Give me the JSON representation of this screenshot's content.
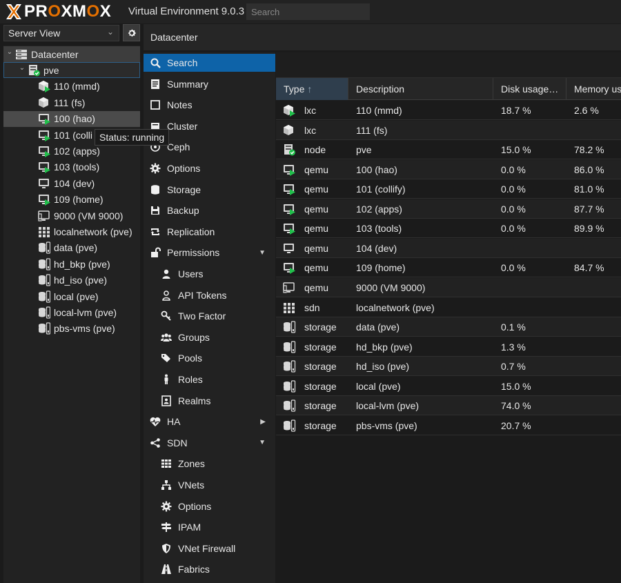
{
  "header": {
    "brand": "PROXMOX",
    "title": "Virtual Environment 9.0.3",
    "search_placeholder": "Search"
  },
  "left": {
    "view_label": "Server View",
    "tree": [
      {
        "label": "Datacenter",
        "icon": "datacenter-icon"
      },
      {
        "label": "pve",
        "icon": "node-online-icon"
      },
      {
        "label": "110 (mmd)",
        "icon": "lxc-running-icon"
      },
      {
        "label": "111 (fs)",
        "icon": "lxc-stopped-icon"
      },
      {
        "label": "100 (hao)",
        "icon": "vm-running-icon"
      },
      {
        "label": "101 (colli",
        "icon": "vm-running-icon"
      },
      {
        "label": "102 (apps)",
        "icon": "vm-running-icon"
      },
      {
        "label": "103 (tools)",
        "icon": "vm-running-icon"
      },
      {
        "label": "104 (dev)",
        "icon": "vm-stopped-icon"
      },
      {
        "label": "109 (home)",
        "icon": "vm-running-icon"
      },
      {
        "label": "9000 (VM 9000)",
        "icon": "vm-template-icon"
      },
      {
        "label": "localnetwork (pve)",
        "icon": "sdn-icon"
      },
      {
        "label": "data (pve)",
        "icon": "storage-icon"
      },
      {
        "label": "hd_bkp (pve)",
        "icon": "storage-icon"
      },
      {
        "label": "hd_iso (pve)",
        "icon": "storage-icon"
      },
      {
        "label": "local (pve)",
        "icon": "storage-icon"
      },
      {
        "label": "local-lvm (pve)",
        "icon": "storage-icon"
      },
      {
        "label": "pbs-vms (pve)",
        "icon": "storage-icon"
      }
    ],
    "tooltip": "Status: running"
  },
  "content": {
    "title": "Datacenter"
  },
  "nav": [
    {
      "label": "Search",
      "icon": "search-icon"
    },
    {
      "label": "Summary",
      "icon": "summary-icon"
    },
    {
      "label": "Notes",
      "icon": "notes-icon"
    },
    {
      "label": "Cluster",
      "icon": "cluster-icon"
    },
    {
      "label": "Ceph",
      "icon": "ceph-icon"
    },
    {
      "label": "Options",
      "icon": "gear-icon"
    },
    {
      "label": "Storage",
      "icon": "database-icon"
    },
    {
      "label": "Backup",
      "icon": "floppy-icon"
    },
    {
      "label": "Replication",
      "icon": "retweet-icon"
    },
    {
      "label": "Permissions",
      "icon": "unlock-icon"
    },
    {
      "label": "Users",
      "icon": "user-icon"
    },
    {
      "label": "API Tokens",
      "icon": "user-outline-icon"
    },
    {
      "label": "Two Factor",
      "icon": "key-icon"
    },
    {
      "label": "Groups",
      "icon": "users-icon"
    },
    {
      "label": "Pools",
      "icon": "tags-icon"
    },
    {
      "label": "Roles",
      "icon": "male-icon"
    },
    {
      "label": "Realms",
      "icon": "address-book-icon"
    },
    {
      "label": "HA",
      "icon": "heartbeat-icon"
    },
    {
      "label": "SDN",
      "icon": "sdn-share-icon"
    },
    {
      "label": "Zones",
      "icon": "grid-icon"
    },
    {
      "label": "VNets",
      "icon": "sitemap-icon"
    },
    {
      "label": "Options",
      "icon": "gear-icon"
    },
    {
      "label": "IPAM",
      "icon": "signpost-icon"
    },
    {
      "label": "VNet Firewall",
      "icon": "shield-icon"
    },
    {
      "label": "Fabrics",
      "icon": "road-icon"
    }
  ],
  "grid": {
    "columns": [
      "Type",
      "Description",
      "Disk usage…",
      "Memory us"
    ],
    "rows": [
      {
        "type": "lxc",
        "icon": "lxc-running-icon",
        "desc": "110 (mmd)",
        "disk": "18.7 %",
        "mem": "2.6 %"
      },
      {
        "type": "lxc",
        "icon": "lxc-stopped-icon",
        "desc": "111 (fs)",
        "disk": "",
        "mem": ""
      },
      {
        "type": "node",
        "icon": "node-online-icon",
        "desc": "pve",
        "disk": "15.0 %",
        "mem": "78.2 %"
      },
      {
        "type": "qemu",
        "icon": "vm-running-icon",
        "desc": "100 (hao)",
        "disk": "0.0 %",
        "mem": "86.0 %"
      },
      {
        "type": "qemu",
        "icon": "vm-running-icon",
        "desc": "101 (collify)",
        "disk": "0.0 %",
        "mem": "81.0 %"
      },
      {
        "type": "qemu",
        "icon": "vm-running-icon",
        "desc": "102 (apps)",
        "disk": "0.0 %",
        "mem": "87.7 %"
      },
      {
        "type": "qemu",
        "icon": "vm-running-icon",
        "desc": "103 (tools)",
        "disk": "0.0 %",
        "mem": "89.9 %"
      },
      {
        "type": "qemu",
        "icon": "vm-stopped-icon",
        "desc": "104 (dev)",
        "disk": "",
        "mem": ""
      },
      {
        "type": "qemu",
        "icon": "vm-running-icon",
        "desc": "109 (home)",
        "disk": "0.0 %",
        "mem": "84.7 %"
      },
      {
        "type": "qemu",
        "icon": "vm-template-icon",
        "desc": "9000 (VM 9000)",
        "disk": "",
        "mem": ""
      },
      {
        "type": "sdn",
        "icon": "sdn-icon",
        "desc": "localnetwork (pve)",
        "disk": "",
        "mem": ""
      },
      {
        "type": "storage",
        "icon": "storage-icon",
        "desc": "data (pve)",
        "disk": "0.1 %",
        "mem": ""
      },
      {
        "type": "storage",
        "icon": "storage-icon",
        "desc": "hd_bkp (pve)",
        "disk": "1.3 %",
        "mem": ""
      },
      {
        "type": "storage",
        "icon": "storage-icon",
        "desc": "hd_iso (pve)",
        "disk": "0.7 %",
        "mem": ""
      },
      {
        "type": "storage",
        "icon": "storage-icon",
        "desc": "local (pve)",
        "disk": "15.0 %",
        "mem": ""
      },
      {
        "type": "storage",
        "icon": "storage-icon",
        "desc": "local-lvm (pve)",
        "disk": "74.0 %",
        "mem": ""
      },
      {
        "type": "storage",
        "icon": "storage-icon",
        "desc": "pbs-vms (pve)",
        "disk": "20.7 %",
        "mem": ""
      }
    ]
  },
  "colors": {
    "accent": "#0e63a8",
    "running": "#21bf4b",
    "brand": "#e57000"
  }
}
